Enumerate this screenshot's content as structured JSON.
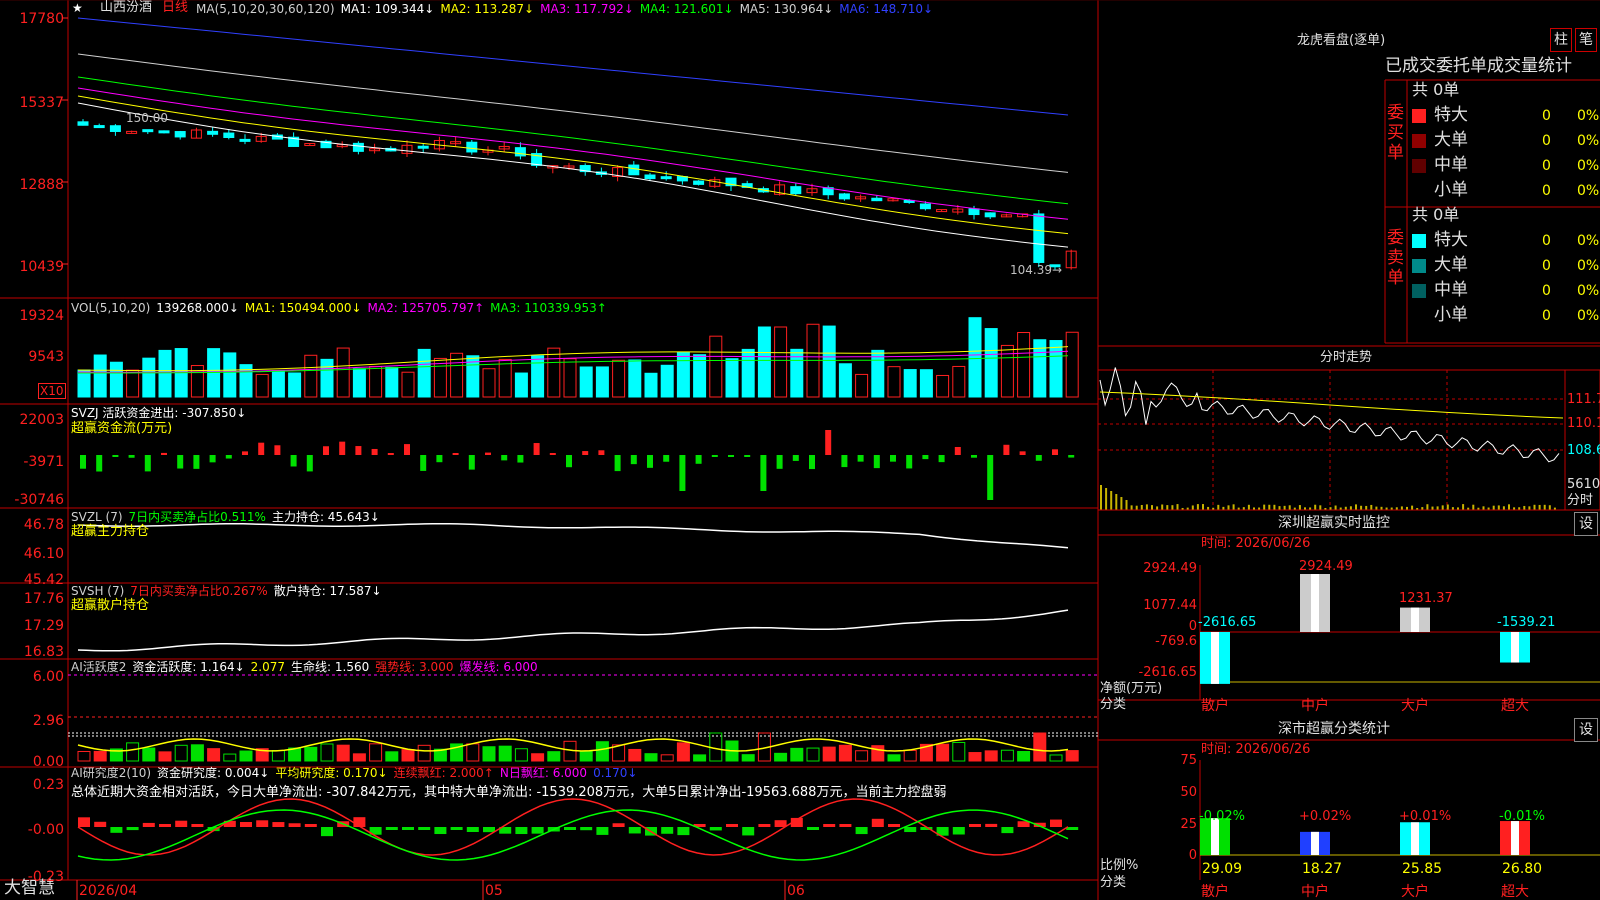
{
  "app": {
    "name": "大智慧"
  },
  "stock": {
    "name": "山西汾酒",
    "period": "日线"
  },
  "colors": {
    "up": "#ff2020",
    "down": "#00ffff",
    "grid": "#c00000",
    "bg": "#000000",
    "sub": "#1a1a1a"
  },
  "price_panel": {
    "y_labels": [
      "17780",
      "15337",
      "12888",
      "10439"
    ],
    "ma_legend": [
      {
        "text": "MA(5,10,20,30,60,120)",
        "color": "#d0d0d0"
      },
      {
        "text": "MA1: 109.344↓",
        "color": "#ffffff"
      },
      {
        "text": "MA2: 113.287↓",
        "color": "#ffff00"
      },
      {
        "text": "MA3: 117.792↓",
        "color": "#ff00ff"
      },
      {
        "text": "MA4: 121.601↓",
        "color": "#00ff00"
      },
      {
        "text": "MA5: 130.964↓",
        "color": "#d0d0d0"
      },
      {
        "text": "MA6: 148.710↓",
        "color": "#3040ff"
      }
    ],
    "high_marker": "150.00",
    "low_marker": "104.39→"
  },
  "vol_panel": {
    "legend": [
      {
        "text": "VOL(5,10,20)",
        "color": "#d0d0d0"
      },
      {
        "text": "139268.000↓",
        "color": "#ffffff"
      },
      {
        "text": "MA1: 150494.000↓",
        "color": "#ffff00"
      },
      {
        "text": "MA2: 125705.797↑",
        "color": "#ff00ff"
      },
      {
        "text": "MA3: 110339.953↑",
        "color": "#00ff00"
      }
    ],
    "y_labels": [
      "19324",
      "9543"
    ],
    "unit": "X10"
  },
  "svzj_panel": {
    "legend": [
      {
        "text": "SVZJ  活跃资金进出: -307.850↓",
        "color": "#ffffff"
      }
    ],
    "subtitle": "超赢资金流(万元)",
    "y_labels": [
      "22003",
      "-3971",
      "-30746"
    ]
  },
  "svzl_panel": {
    "legend": [
      {
        "text": "SVZL  (7)",
        "color": "#d0d0d0"
      },
      {
        "text": "7日内买卖净占比0.511%",
        "color": "#00ff00"
      },
      {
        "text": "主力持仓: 45.643↓",
        "color": "#ffffff"
      }
    ],
    "subtitle": "超赢主力持仓",
    "y_labels": [
      "46.78",
      "46.10",
      "45.42"
    ]
  },
  "svsh_panel": {
    "legend": [
      {
        "text": "SVSH  (7)",
        "color": "#d0d0d0"
      },
      {
        "text": "7日内买卖净占比0.267%",
        "color": "#ff2020"
      },
      {
        "text": "散户持仓: 17.587↓",
        "color": "#ffffff"
      }
    ],
    "subtitle": "超赢散户持仓",
    "y_labels": [
      "17.76",
      "17.29",
      "16.83"
    ]
  },
  "ai_active_panel": {
    "legend": [
      {
        "text": "AI活跃度2",
        "color": "#d0d0d0"
      },
      {
        "text": "资金活跃度: 1.164↓",
        "color": "#ffffff"
      },
      {
        "text": "2.077",
        "color": "#ffff00"
      },
      {
        "text": "生命线: 1.560",
        "color": "#ffffff"
      },
      {
        "text": "强势线: 3.000",
        "color": "#ff2020"
      },
      {
        "text": "爆发线: 6.000",
        "color": "#ff00ff"
      }
    ],
    "y_labels": [
      "6.00",
      "2.96",
      "0.00"
    ]
  },
  "ai_research_panel": {
    "legend": [
      {
        "text": "AI研究度2(10)",
        "color": "#d0d0d0"
      },
      {
        "text": "资金研究度: 0.004↓",
        "color": "#ffffff"
      },
      {
        "text": "平均研究度: 0.170↓",
        "color": "#ffff00"
      },
      {
        "text": "连续飘红: 2.000↑",
        "color": "#ff2020"
      },
      {
        "text": "N日飘红: 6.000",
        "color": "#ff00ff"
      },
      {
        "text": "0.170↓",
        "color": "#3040ff"
      }
    ],
    "summary": "总体近期大资金相对活跃，今日大单净流出: -307.842万元，其中特大单净流出: -1539.208万元，大单5日累计净出-19563.688万元，当前主力控盘弱",
    "y_labels": [
      "0.23",
      "-0.00",
      "-0.23"
    ]
  },
  "date_axis": [
    "2026/04",
    "05",
    "06"
  ],
  "right": {
    "title": "龙虎看盘(逐单)",
    "btn_bar": "柱",
    "btn_pen": "笔",
    "stats_header": "已成交委托单成交量统计",
    "buy": {
      "side": "委买单",
      "total": "共 0单",
      "rows": [
        {
          "label": "特大",
          "count": "0",
          "pct": "0%",
          "color": "#ff2020"
        },
        {
          "label": "大单",
          "count": "0",
          "pct": "0%",
          "color": "#900000"
        },
        {
          "label": "中单",
          "count": "0",
          "pct": "0%",
          "color": "#600000"
        },
        {
          "label": "小单",
          "count": "0",
          "pct": "0%",
          "color": ""
        }
      ]
    },
    "sell": {
      "side": "委卖单",
      "total": "共 0单",
      "rows": [
        {
          "label": "特大",
          "count": "0",
          "pct": "0%",
          "color": "#00ffff"
        },
        {
          "label": "大单",
          "count": "0",
          "pct": "0%",
          "color": "#008a8a"
        },
        {
          "label": "中单",
          "count": "0",
          "pct": "0%",
          "color": "#006060"
        },
        {
          "label": "小单",
          "count": "0",
          "pct": "0%",
          "color": ""
        }
      ]
    },
    "intraday": {
      "title": "分时走势",
      "labels": [
        "111.7",
        "110.1",
        "108.6"
      ],
      "vol_label": "5610",
      "vol_unit": "分时"
    },
    "monitor": {
      "title": "深圳超赢实时监控",
      "settings": "设",
      "time": "时间: 2026/06/26",
      "y_labels": [
        "2924.49",
        "1077.44",
        "0",
        "-769.6",
        "-2616.65"
      ],
      "axis_title": "净额(万元)",
      "axis_sub": "分类",
      "categories": [
        "散户",
        "中户",
        "大户",
        "超大"
      ],
      "values": [
        "-2616.65",
        "2924.49",
        "1231.37",
        "-1539.21"
      ]
    },
    "classify": {
      "title": "深市超赢分类统计",
      "settings": "设",
      "time": "时间: 2026/06/26",
      "y_labels": [
        "75",
        "50",
        "25",
        "0"
      ],
      "axis_title": "比例%",
      "axis_sub": "分类",
      "categories": [
        "散户",
        "中户",
        "大户",
        "超大"
      ],
      "changes": [
        "-0.02%",
        "+0.02%",
        "+0.01%",
        "-0.01%"
      ],
      "values": [
        "29.09",
        "18.27",
        "25.85",
        "26.80"
      ]
    }
  },
  "chart_data": [
    {
      "type": "candlestick",
      "title": "山西汾酒 日线",
      "ylim": [
        104.39,
        177.8
      ],
      "high": 150.0,
      "low": 104.39,
      "ma_values": {
        "MA1": 109.344,
        "MA2": 113.287,
        "MA3": 117.792,
        "MA4": 121.601,
        "MA5": 130.964,
        "MA6": 148.71
      }
    },
    {
      "type": "bar",
      "title": "VOL(5,10,20)",
      "values": {
        "VOL": 139268.0,
        "MA1": 150494.0,
        "MA2": 125705.797,
        "MA3": 110339.953
      }
    },
    {
      "type": "bar",
      "title": "SVZJ",
      "values": {
        "活跃资金进出": -307.85
      }
    },
    {
      "type": "line",
      "title": "SVZL (7)",
      "values": {
        "主力持仓": 45.643
      }
    },
    {
      "type": "line",
      "title": "SVSH (7)",
      "values": {
        "散户持仓": 17.587
      }
    },
    {
      "type": "bar",
      "title": "深圳超赢实时监控",
      "categories": [
        "散户",
        "中户",
        "大户",
        "超大"
      ],
      "values": [
        -2616.65,
        2924.49,
        1231.37,
        -1539.21
      ]
    },
    {
      "type": "bar",
      "title": "深市超赢分类统计",
      "categories": [
        "散户",
        "中户",
        "大户",
        "超大"
      ],
      "values": [
        29.09,
        18.27,
        25.85,
        26.8
      ]
    }
  ]
}
